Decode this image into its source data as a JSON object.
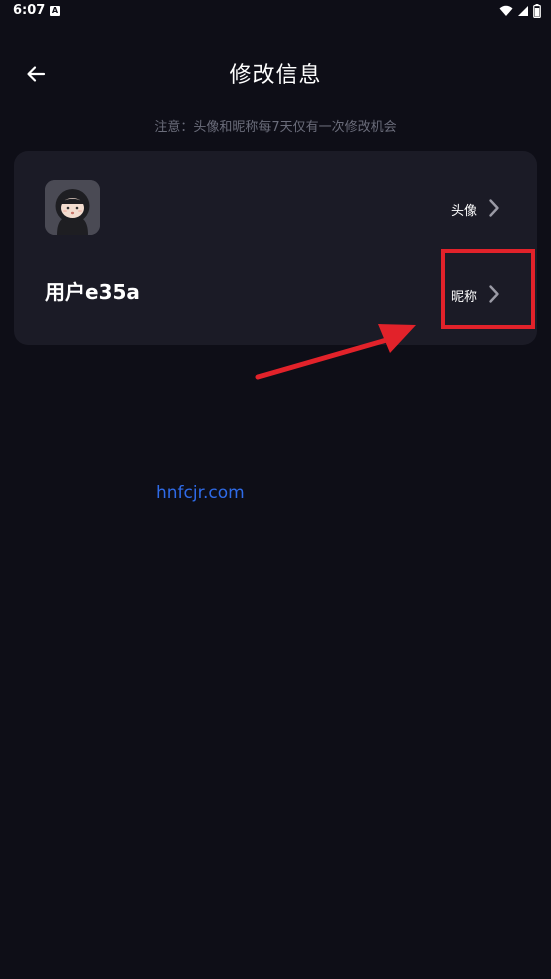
{
  "status_bar": {
    "time": "6:07",
    "notification_icon": "a-icon",
    "icons": [
      "wifi-icon",
      "signal-icon",
      "battery-icon"
    ]
  },
  "header": {
    "back_icon": "back-arrow-icon",
    "title": "修改信息"
  },
  "notice": "注意：头像和昵称每7天仅有一次修改机会",
  "card": {
    "avatar_row": {
      "label": "头像",
      "chevron_icon": "chevron-right-icon"
    },
    "nickname_row": {
      "value": "用户e35a",
      "label": "昵称",
      "chevron_icon": "chevron-right-icon"
    }
  },
  "annotation": {
    "highlight_color": "#e2222a"
  },
  "watermark": "hnfcjr.com",
  "colors": {
    "background": "#0e0e17",
    "card": "#1b1b26",
    "notice_text": "#6a6c7a",
    "watermark": "#2f6be8"
  }
}
